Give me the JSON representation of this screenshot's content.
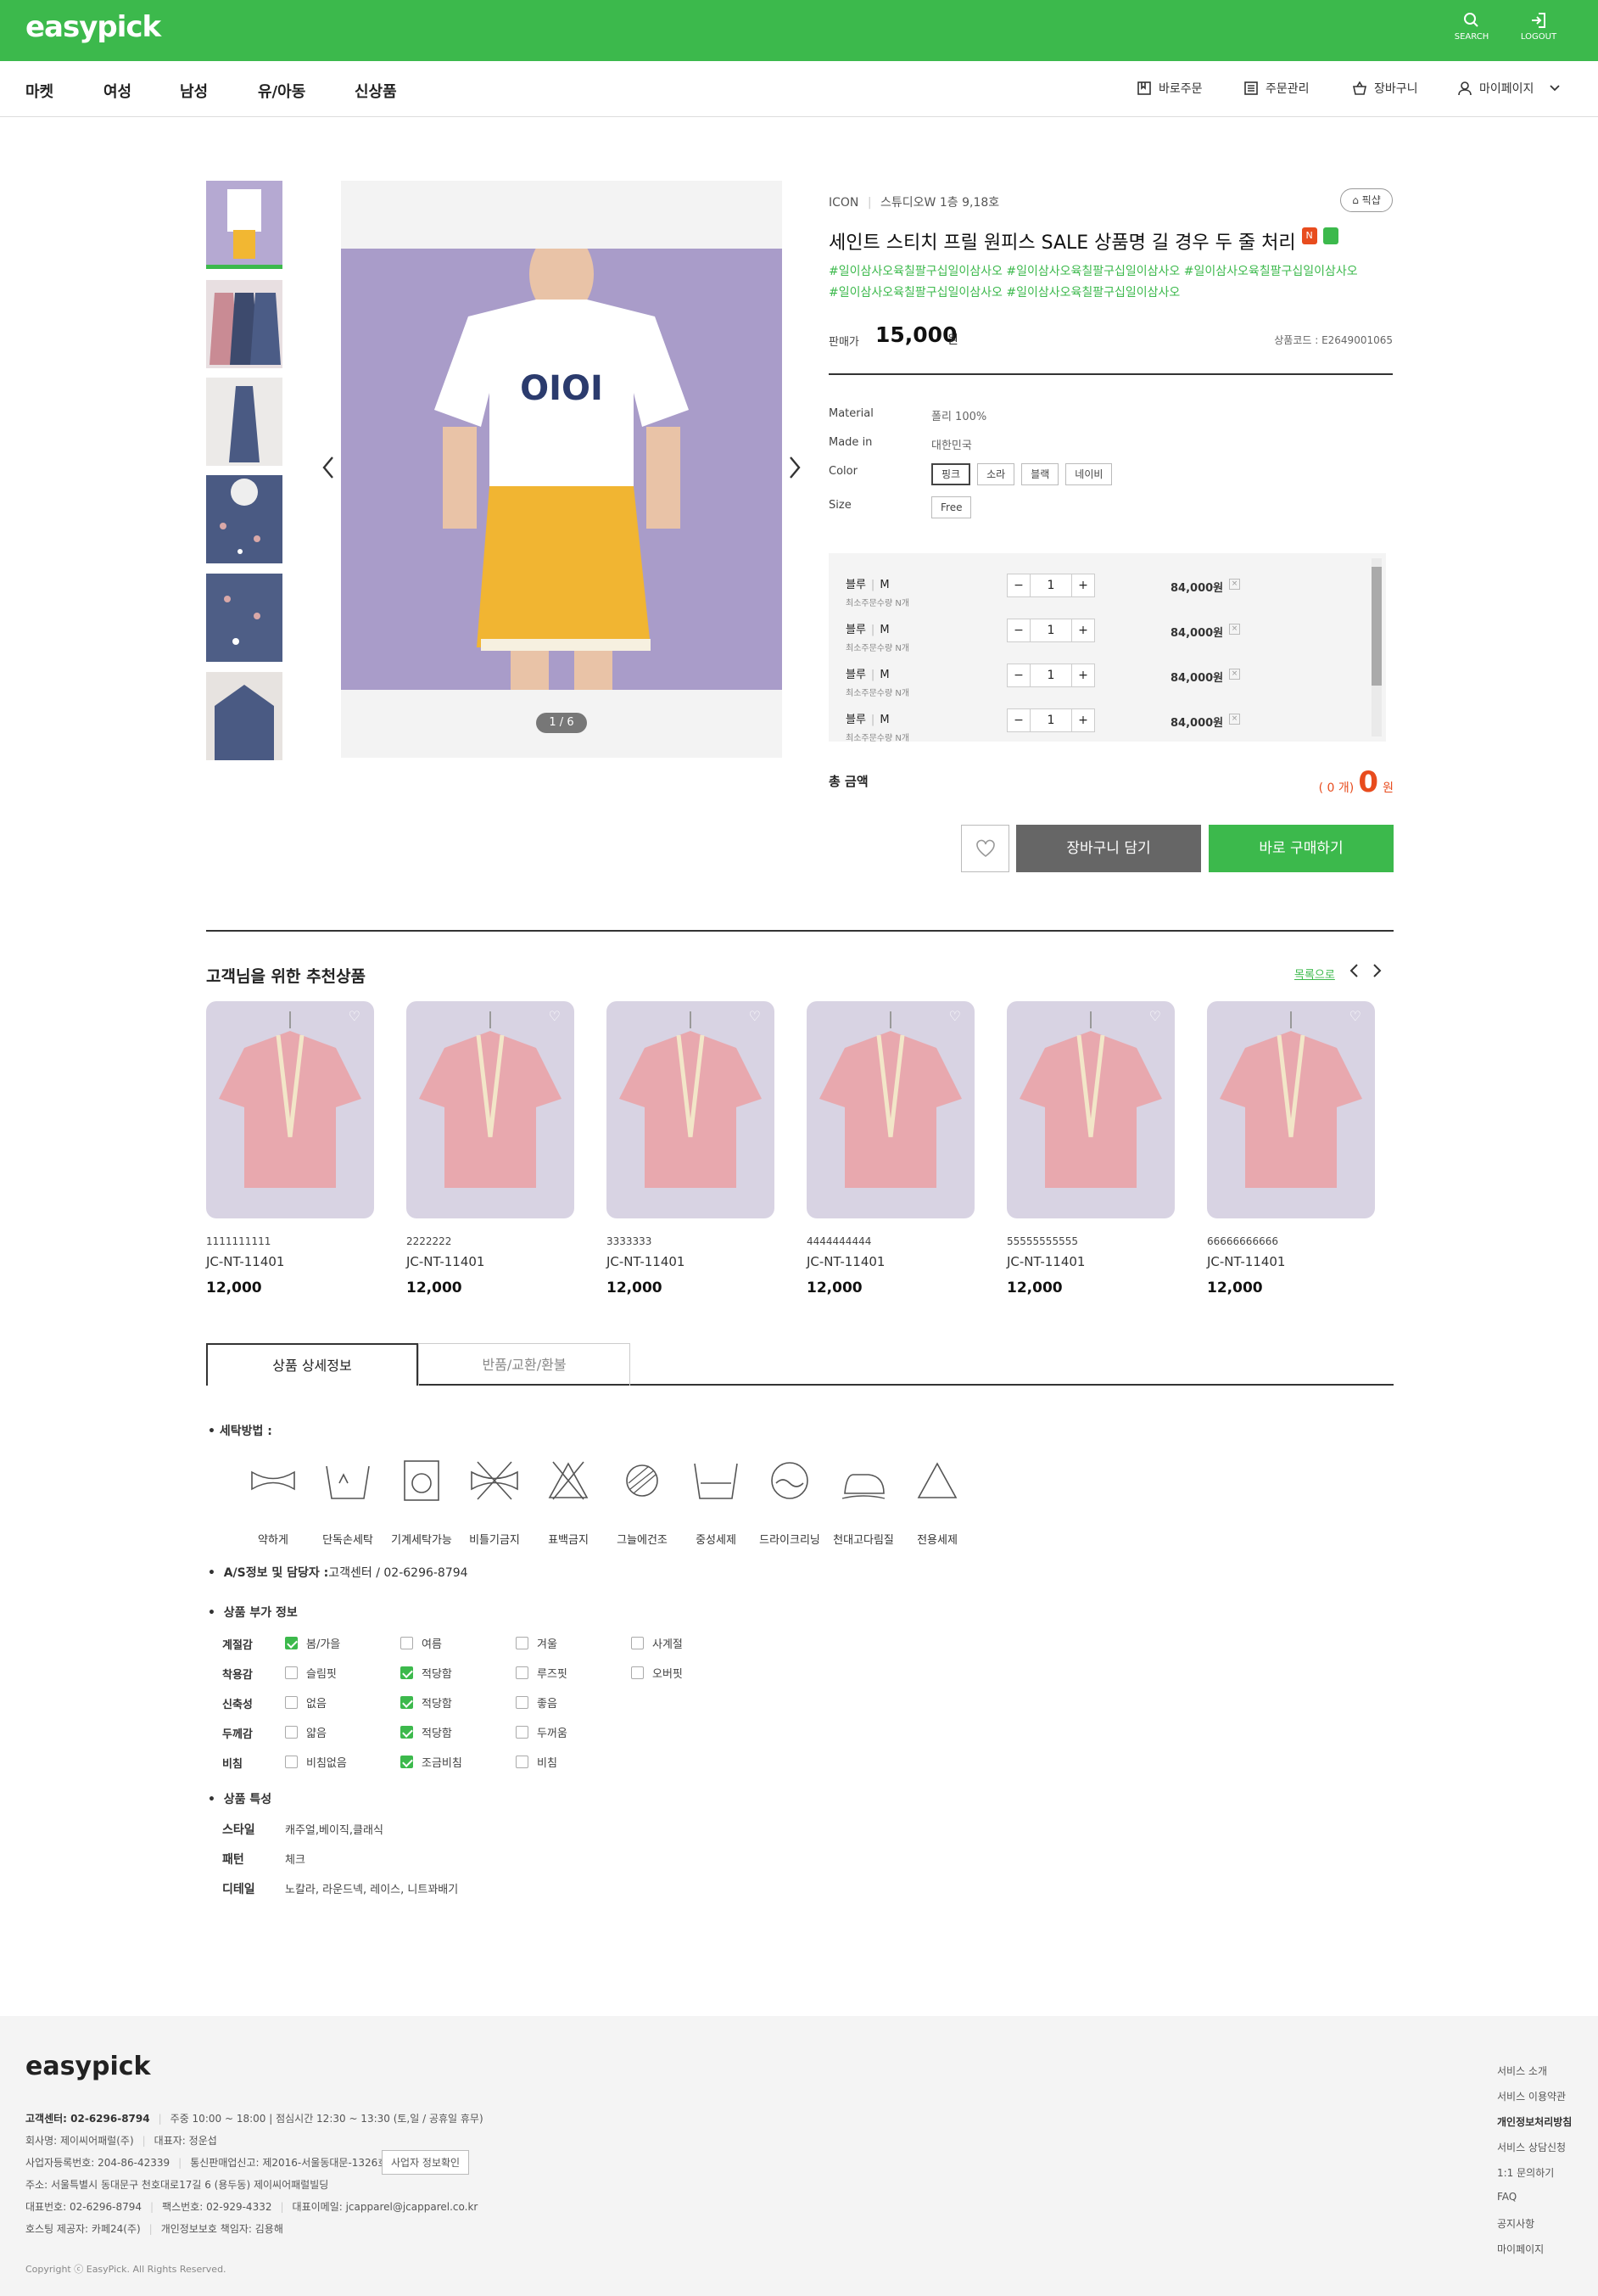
{
  "header": {
    "logo": "easypick",
    "search_label": "SEARCH",
    "logout_label": "LOGOUT"
  },
  "nav": {
    "items": [
      "마켓",
      "여성",
      "남성",
      "유/아동",
      "신상품"
    ],
    "utils": [
      "바로주문",
      "주문관리",
      "장바구니",
      "마이페이지"
    ]
  },
  "gallery": {
    "counter": "1 / 6",
    "shirt_text": "OIOI"
  },
  "product": {
    "brand": "ICON",
    "brand_sub": "스튜디오W 1층 9,18호",
    "share_label": "픽샵",
    "title": "세인트 스티치 프릴 원피스 SALE 상품명 길 경우 두 줄 처리",
    "tags_line1": "#일이삼사오육칠팔구십일이삼사오 #일이삼사오육칠팔구십일이삼사오 #일이삼사오육칠팔구십일이삼사오",
    "tags_line2": "#일이삼사오육칠팔구십일이삼사오 #일이삼사오육칠팔구십일이삼사오",
    "price_label": "판매가",
    "price": "15,000",
    "price_unit": "원",
    "code": "상품코드 : E2649001065",
    "material_label": "Material",
    "material": "폴리 100%",
    "madein_label": "Made in",
    "madein": "대한민국",
    "color_label": "Color",
    "colors": [
      "핑크",
      "소라",
      "블랙",
      "네이비"
    ],
    "size_label": "Size",
    "sizes": [
      "Free"
    ]
  },
  "options": [
    {
      "name": "블루",
      "size": "M",
      "min": "최소주문수량 N개",
      "qty": "1",
      "price": "84,000원"
    },
    {
      "name": "블루",
      "size": "M",
      "min": "최소주문수량 N개",
      "qty": "1",
      "price": "84,000원"
    },
    {
      "name": "블루",
      "size": "M",
      "min": "최소주문수량 N개",
      "qty": "1",
      "price": "84,000원"
    },
    {
      "name": "블루",
      "size": "M",
      "min": "최소주문수량 N개",
      "qty": "1",
      "price": "84,000원"
    }
  ],
  "total": {
    "label": "총 금액",
    "count": "( 0 개)",
    "amount": "0",
    "unit": "원"
  },
  "actions": {
    "cart": "장바구니 담기",
    "buy": "바로 구매하기"
  },
  "recommend": {
    "title": "고객님을 위한 추천상품",
    "more": "목록으로",
    "items": [
      {
        "num": "1111111111",
        "code": "JC-NT-11401",
        "price": "12,000"
      },
      {
        "num": "2222222",
        "code": "JC-NT-11401",
        "price": "12,000"
      },
      {
        "num": "3333333",
        "code": "JC-NT-11401",
        "price": "12,000"
      },
      {
        "num": "4444444444",
        "code": "JC-NT-11401",
        "price": "12,000"
      },
      {
        "num": "55555555555",
        "code": "JC-NT-11401",
        "price": "12,000"
      },
      {
        "num": "66666666666",
        "code": "JC-NT-11401",
        "price": "12,000"
      }
    ]
  },
  "tabs": [
    "상품 상세정보",
    "반품/교환/환불"
  ],
  "detail": {
    "wash_title": "세탁방법 :",
    "care": [
      "약하게",
      "단독손세탁",
      "기계세탁가능",
      "비틀기금지",
      "표백금지",
      "그늘에건조",
      "중성세제",
      "드라이크리닝",
      "천대고다림질",
      "전용세제"
    ],
    "as_title": "A/S정보 및 담당자 :",
    "as_value": "고객센터 / 02-6296-8794",
    "extra_title": "상품 부가 정보",
    "attrs": [
      {
        "label": "계절감",
        "opts": [
          "봄/가을",
          "여름",
          "겨울",
          "사계절"
        ],
        "checked": 0
      },
      {
        "label": "착용감",
        "opts": [
          "슬림핏",
          "적당함",
          "루즈핏",
          "오버핏"
        ],
        "checked": 1
      },
      {
        "label": "신축성",
        "opts": [
          "없음",
          "적당함",
          "좋음"
        ],
        "checked": 1
      },
      {
        "label": "두께감",
        "opts": [
          "얇음",
          "적당함",
          "두꺼움"
        ],
        "checked": 1
      },
      {
        "label": "비침",
        "opts": [
          "비침없음",
          "조금비침",
          "비침"
        ],
        "checked": 1
      }
    ],
    "feature_title": "상품 특성",
    "features": [
      {
        "label": "스타일",
        "value": "캐주얼,베이직,클래식"
      },
      {
        "label": "패턴",
        "value": "체크"
      },
      {
        "label": "디테일",
        "value": "노칼라, 라운드넥, 레이스, 니트꽈배기"
      }
    ]
  },
  "footer": {
    "logo": "easypick",
    "cs": "고객센터: 02-6296-8794",
    "hours": "주중 10:00 ~ 18:00 | 점심시간 12:30 ~ 13:30 (토,일 / 공휴일 휴무)",
    "company": "회사명: 제이씨어패럴(주)",
    "ceo": "대표자: 정운섭",
    "bizno": "사업자등록번호: 204-86-42339",
    "mailorder": "통신판매업신고: 제2016-서울동대문-1326호",
    "bizinfo_btn": "사업자 정보확인",
    "address": "주소: 서울특별시 동대문구 천호대로17길 6 (용두동) 제이씨어패럴빌딩",
    "tel": "대표번호: 02-6296-8794",
    "fax": "팩스번호: 02-929-4332",
    "email": "대표이메일: jcapparel@jcapparel.co.kr",
    "hosting": "호스팅 제공자: 카페24(주)",
    "privacy_officer": "개인정보보호 책임자: 김용해",
    "copyright": "Copyright ⓒ EasyPick. All Rights Reserved.",
    "links": [
      "서비스 소개",
      "서비스 이용약관",
      "개인정보처리방침",
      "서비스 상담신청",
      "1:1 문의하기",
      "FAQ",
      "공지사항",
      "마이페이지"
    ]
  },
  "colors": {
    "brand": "#3cb94c",
    "accent": "#e84c1e",
    "cart": "#666666"
  }
}
